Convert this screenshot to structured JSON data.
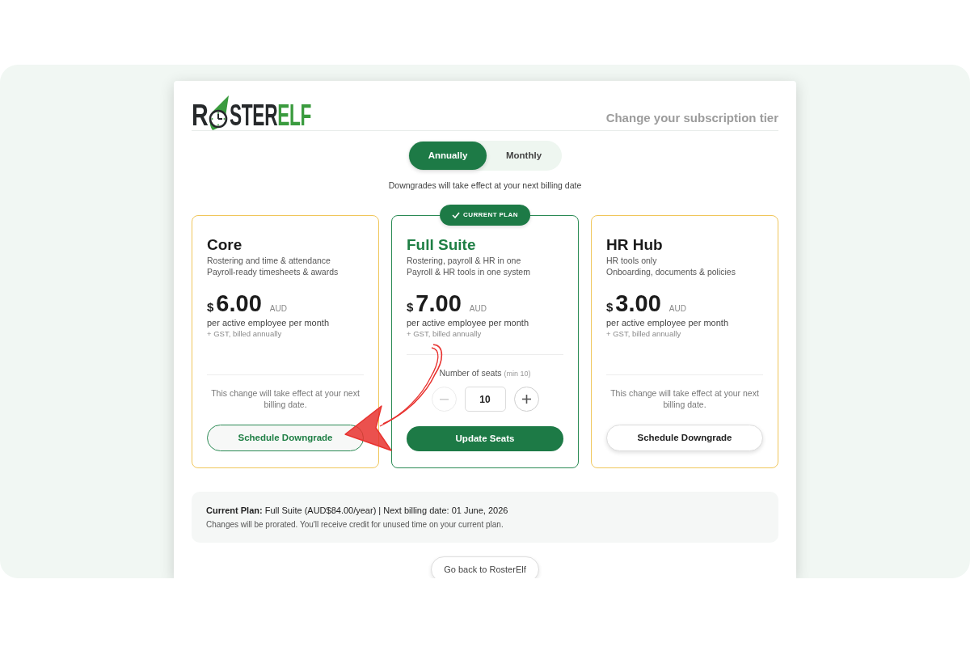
{
  "logo": {
    "lead": "R",
    "dark": "STER",
    "accent": "ELF"
  },
  "page_title": "Change your subscription tier",
  "billing_toggle": [
    {
      "label": "Annually",
      "selected": true
    },
    {
      "label": "Monthly",
      "selected": false
    }
  ],
  "notice": "Downgrades will take effect at your next billing date",
  "plans": [
    {
      "name": "Core",
      "current": false,
      "descriptions": [
        "Rostering and time & attendance",
        "Payroll-ready timesheets & awards"
      ],
      "currency_symbol": "$",
      "price": "6.00",
      "currency": "AUD",
      "unit": "per active employee per month",
      "billing": "+ GST, billed annually",
      "note": "This change will take effect at your next billing date.",
      "action": {
        "label": "Schedule Downgrade",
        "kind": "accent"
      }
    },
    {
      "name": "Full Suite",
      "current": true,
      "badge": "CURRENT PLAN",
      "descriptions": [
        "Rostering, payroll & HR in one",
        "Payroll & HR tools in one system"
      ],
      "currency_symbol": "$",
      "price": "7.00",
      "currency": "AUD",
      "unit": "per active employee per month",
      "billing": "+ GST, billed annually",
      "seats": {
        "label": "Number of seats",
        "hint": "(min 10)",
        "value": "10",
        "decrease_disabled": true
      },
      "action": {
        "label": "Update Seats",
        "kind": "primary"
      }
    },
    {
      "name": "HR Hub",
      "current": false,
      "descriptions": [
        "HR tools only",
        "Onboarding, documents & policies"
      ],
      "currency_symbol": "$",
      "price": "3.00",
      "currency": "AUD",
      "unit": "per active employee per month",
      "billing": "+ GST, billed annually",
      "note": "This change will take effect at your next billing date.",
      "action": {
        "label": "Schedule Downgrade",
        "kind": "plain"
      }
    }
  ],
  "summary": {
    "text": "**Current Plan:** Full Suite (AUD$84.00/year) | Next billing date: 01 June, 2026",
    "note": "Changes will be prorated. You'll receive credit for unused time on your current plan."
  },
  "back_button": "Go back to RosterElf",
  "annotation": {
    "kind": "arrow"
  }
}
